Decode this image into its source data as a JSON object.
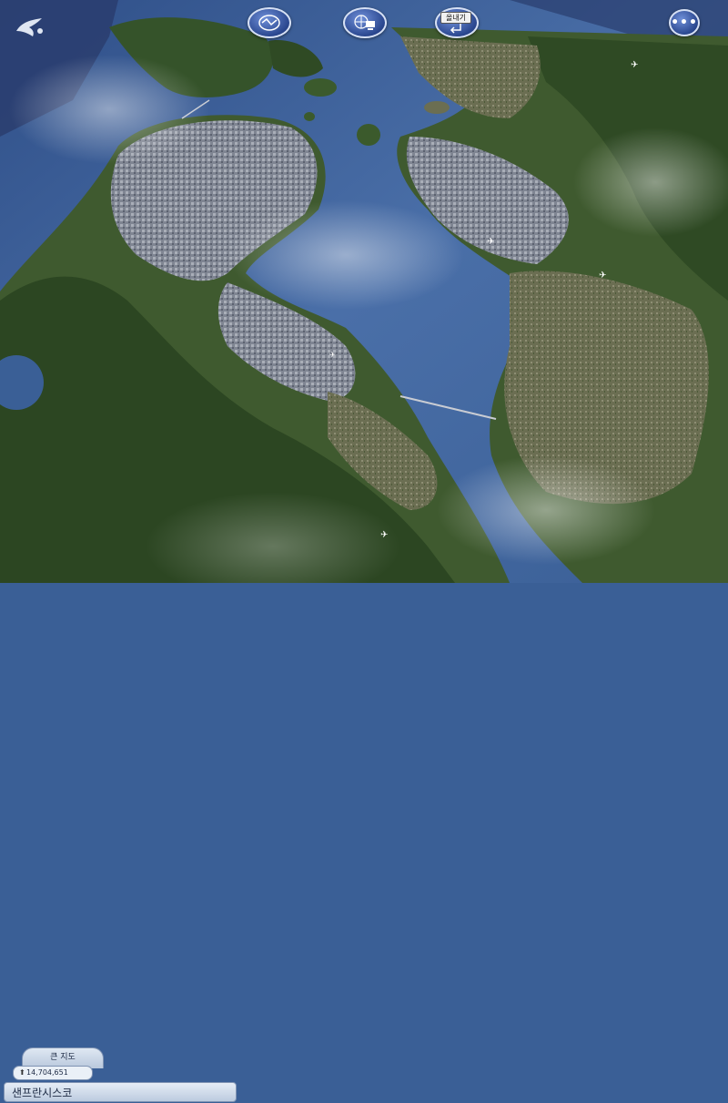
{
  "toolbar": {
    "region_icon": "region-view-icon",
    "network_icon": "computer-network-icon",
    "export_label": "올내기",
    "menu_icon": "more-options-icon",
    "menu_glyph": "•••"
  },
  "info_panel": {
    "big_map_label": "큰 지도",
    "population": "14,704,651",
    "city_name": "샌프란시스코"
  },
  "colors": {
    "water": "#3a5f96",
    "land": "#3f5a2f",
    "hills": "#2f4a24",
    "city": "#8a8f99",
    "button": "#2a478f"
  }
}
